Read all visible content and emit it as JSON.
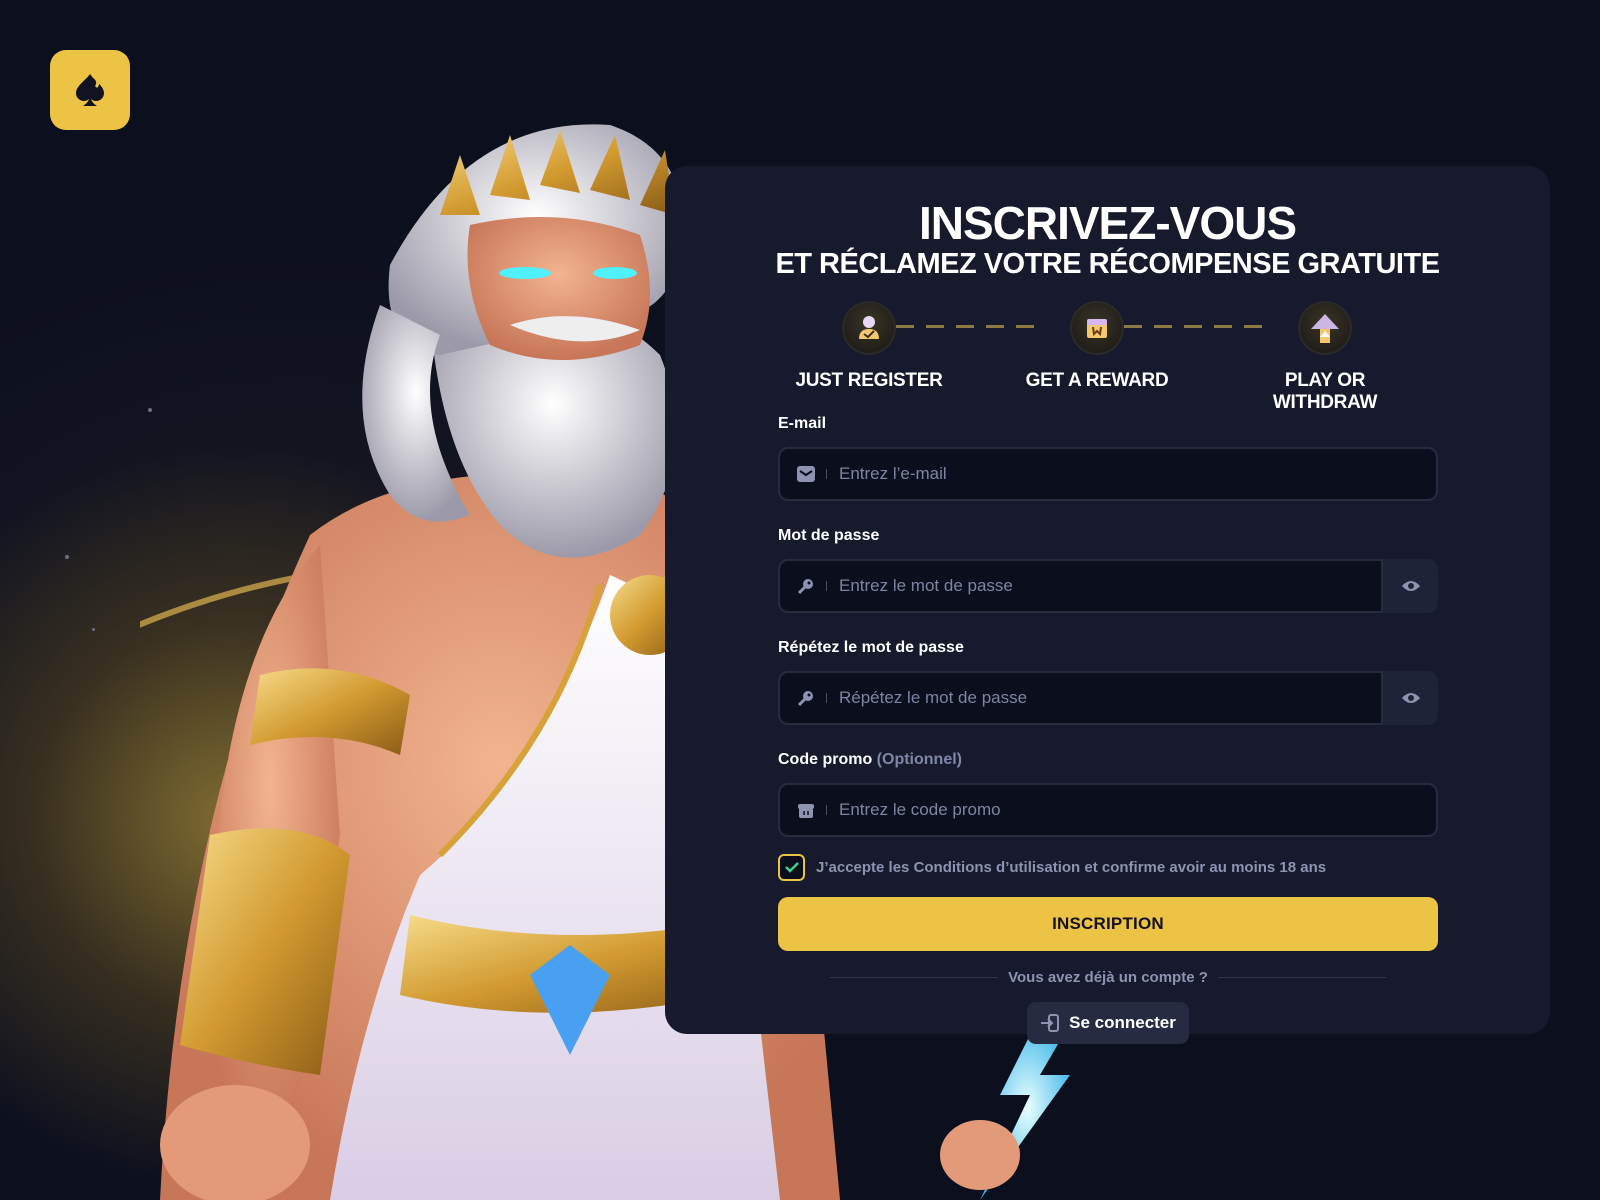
{
  "brand": {
    "logo_icon": "spade-icon",
    "accent_color": "#ecc344"
  },
  "header": {
    "title": "INSCRIVEZ-VOUS",
    "subtitle": "ET RÉCLAMEZ VOTRE RÉCOMPENSE GRATUITE"
  },
  "steps": [
    {
      "label": "JUST REGISTER",
      "icon": "user-check-icon"
    },
    {
      "label": "GET A REWARD",
      "icon": "gift-icon"
    },
    {
      "label": "PLAY OR WITHDRAW",
      "icon": "arrow-up-icon"
    }
  ],
  "form": {
    "email": {
      "label": "E-mail",
      "placeholder": "Entrez l’e-mail",
      "value": "",
      "icon": "mail-icon"
    },
    "password": {
      "label": "Mot de passe",
      "placeholder": "Entrez le mot de passe",
      "value": "",
      "icon": "key-icon"
    },
    "repeat_password": {
      "label": "Répétez le mot de passe",
      "placeholder": "Répétez le mot de passe",
      "value": "",
      "icon": "key-icon"
    },
    "promo": {
      "label": "Code promo",
      "optional": "(Optionnel)",
      "placeholder": "Entrez le code promo",
      "value": "",
      "icon": "gift-icon"
    },
    "terms": {
      "text": "J’accepte les Conditions d’utilisation et confirme avoir au moins 18 ans",
      "checked": true
    },
    "submit_label": "INSCRIPTION"
  },
  "footer": {
    "have_account": "Vous avez déjà un compte ?",
    "login_label": "Se connecter"
  }
}
